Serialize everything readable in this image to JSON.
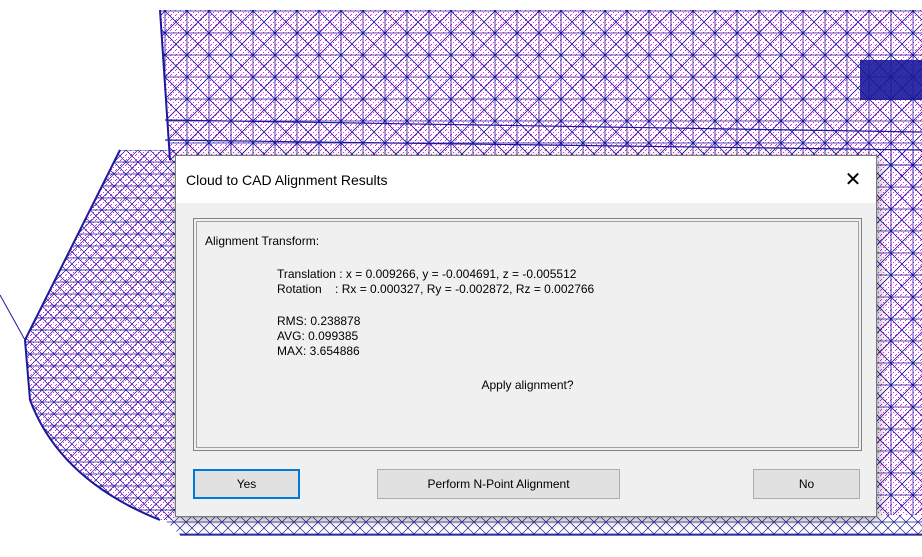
{
  "dialog": {
    "title": "Cloud to CAD Alignment Results",
    "close_glyph": "✕",
    "panel_heading": "Alignment Transform:",
    "translation_line": "Translation : x = 0.009266, y = -0.004691, z = -0.005512",
    "rotation_line": "Rotation    : Rx = 0.000327, Ry = -0.002872, Rz = 0.002766",
    "rms_line": "RMS: 0.238878",
    "avg_line": "AVG: 0.099385",
    "max_line": "MAX: 3.654886",
    "prompt": "Apply alignment?",
    "buttons": {
      "yes": "Yes",
      "n_point": "Perform N-Point Alignment",
      "no": "No"
    }
  },
  "colors": {
    "mesh_wire": "#1a1a9a",
    "point_cloud": "#ee22ee",
    "default_button_border": "#0078d7"
  },
  "icons": {
    "close": "close-icon"
  }
}
